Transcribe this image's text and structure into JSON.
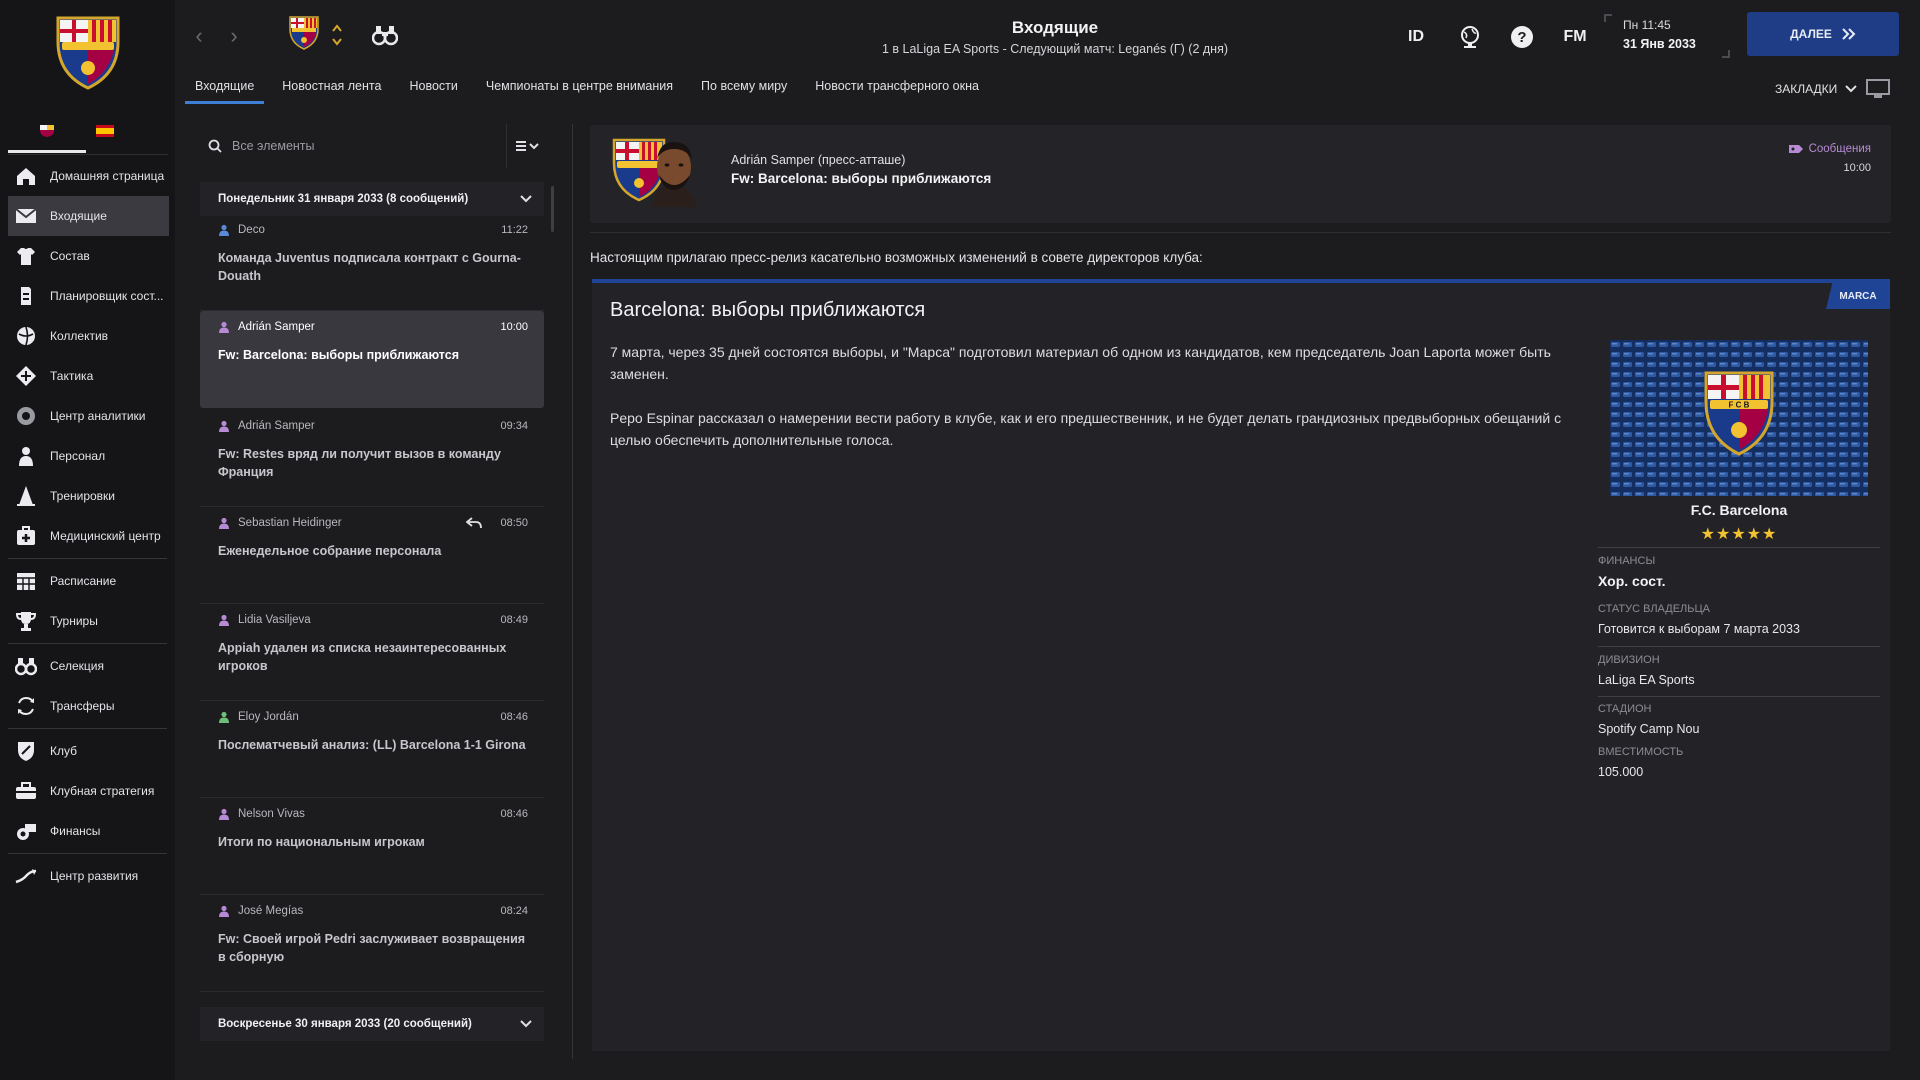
{
  "sidebar": {
    "items": [
      {
        "label": "Домашняя страница",
        "icon": "home-icon",
        "name": "sidebar-item-home"
      },
      {
        "label": "Входящие",
        "icon": "inbox-icon",
        "name": "sidebar-item-inbox",
        "active": true
      },
      {
        "label": "Состав",
        "icon": "shirt-icon",
        "name": "sidebar-item-squad"
      },
      {
        "label": "Планировщик сост...",
        "icon": "squad-planner-icon",
        "name": "sidebar-item-squad-planner"
      },
      {
        "label": "Коллектив",
        "icon": "dynamics-icon",
        "name": "sidebar-item-dynamics"
      },
      {
        "label": "Тактика",
        "icon": "tactics-icon",
        "name": "sidebar-item-tactics"
      },
      {
        "label": "Центр аналитики",
        "icon": "analytics-icon",
        "name": "sidebar-item-analytics"
      },
      {
        "label": "Персонал",
        "icon": "staff-icon",
        "name": "sidebar-item-staff"
      },
      {
        "label": "Тренировки",
        "icon": "training-cone-icon",
        "name": "sidebar-item-training"
      },
      {
        "label": "Медицинский центр",
        "icon": "medical-icon",
        "name": "sidebar-item-medical"
      },
      {
        "label": "Расписание",
        "icon": "calendar-icon",
        "name": "sidebar-item-schedule"
      },
      {
        "label": "Турниры",
        "icon": "trophy-icon",
        "name": "sidebar-item-competitions"
      },
      {
        "label": "Селекция",
        "icon": "binoculars-icon",
        "name": "sidebar-item-scouting"
      },
      {
        "label": "Трансферы",
        "icon": "transfers-icon",
        "name": "sidebar-item-transfers"
      },
      {
        "label": "Клуб",
        "icon": "shield-icon",
        "name": "sidebar-item-club"
      },
      {
        "label": "Клубная стратегия",
        "icon": "briefcase-icon",
        "name": "sidebar-item-club-vision"
      },
      {
        "label": "Финансы",
        "icon": "money-icon",
        "name": "sidebar-item-finances"
      },
      {
        "label": "Центр развития",
        "icon": "development-icon",
        "name": "sidebar-item-development"
      }
    ]
  },
  "topbar": {
    "title": "Входящие",
    "subtitle": "1 в LaLiga EA Sports - Следующий матч: Leganés (Г) (2 дня)",
    "id_label": "ID",
    "fm_label": "FM",
    "day_time": "Пн 11:45",
    "date": "31 Янв 2033",
    "continue_label": "ДАЛЕЕ",
    "bookmarks_label": "ЗАКЛАДКИ",
    "accent": "#1e3d86"
  },
  "tabs": [
    "Входящие",
    "Новостная лента",
    "Новости",
    "Чемпионаты в центре внимания",
    "По всему миру",
    "Новости трансферного окна"
  ],
  "inbox": {
    "search_placeholder": "Все элементы",
    "day_header_1": "Понедельник 31 января 2033 (8 сообщений)",
    "day_header_2": "Воскресенье 30 января 2033 (20 сообщений)",
    "messages": [
      {
        "from": "Deco",
        "time": "11:22",
        "subject": "Команда Juventus подписала контракт с Gourna-Douath",
        "icon": "person-blue"
      },
      {
        "from": "Adrián Samper",
        "time": "10:00",
        "subject": "Fw: Barcelona: выборы приближаются",
        "icon": "person-purple",
        "selected": true
      },
      {
        "from": "Adrián Samper",
        "time": "09:34",
        "subject": "Fw: Restes вряд ли получит вызов в команду Франция",
        "icon": "person-purple"
      },
      {
        "from": "Sebastian Heidinger",
        "time": "08:50",
        "subject": "Еженедельное собрание персонала",
        "icon": "person-purple",
        "replied": true
      },
      {
        "from": "Lidia Vasiljeva",
        "time": "08:49",
        "subject": "Appiah удален из списка незаинтересованных игроков",
        "icon": "person-purple"
      },
      {
        "from": "Eloy Jordán",
        "time": "08:46",
        "subject": "Послематчевый анализ: (LL) Barcelona 1-1 Girona",
        "icon": "person-green"
      },
      {
        "from": "Nelson Vivas",
        "time": "08:46",
        "subject": "Итоги по национальным игрокам",
        "icon": "person-purple"
      },
      {
        "from": "José Megías",
        "time": "08:24",
        "subject": "Fw: Своей игрой Pedri заслуживает возвращения в сборную",
        "icon": "person-purple"
      }
    ]
  },
  "message": {
    "sender": "Adrián Samper  (пресс-атташе)",
    "subject": "Fw: Barcelona: выборы приближаются",
    "tag": "Сообщения",
    "time": "10:00",
    "intro": "Настоящим прилагаю пресс-релиз касательно возможных изменений в совете директоров клуба:",
    "source": "MARCA",
    "article_title": "Barcelona: выборы приближаются",
    "paragraph_1": "7 марта, через 35 дней состоятся выборы, и \"Марса\" подготовил материал об одном из кандидатов, кем председатель Joan Laporta может быть заменен.",
    "paragraph_2": "Pepo Espinar рассказал о намерении вести работу в клубе, как и его предшественник, и не будет делать грандиозных предвыборных обещаний с целью обеспечить дополнительные голоса."
  },
  "club_card": {
    "name": "F.C. Barcelona",
    "rating_stars": 5,
    "stars_text": "★★★★★",
    "finances_label": "ФИНАНСЫ",
    "finances_value": "Хор. сост.",
    "owner_status_label": "СТАТУС ВЛАДЕЛЬЦА",
    "owner_status_value": "Готовится к выборам 7 марта 2033",
    "division_label": "ДИВИЗИОН",
    "division_value": "LaLiga EA Sports",
    "stadium_label": "СТАДИОН",
    "stadium_value": "Spotify Camp Nou",
    "capacity_label": "ВМЕСТИМОСТЬ",
    "capacity_value": "105.000"
  }
}
